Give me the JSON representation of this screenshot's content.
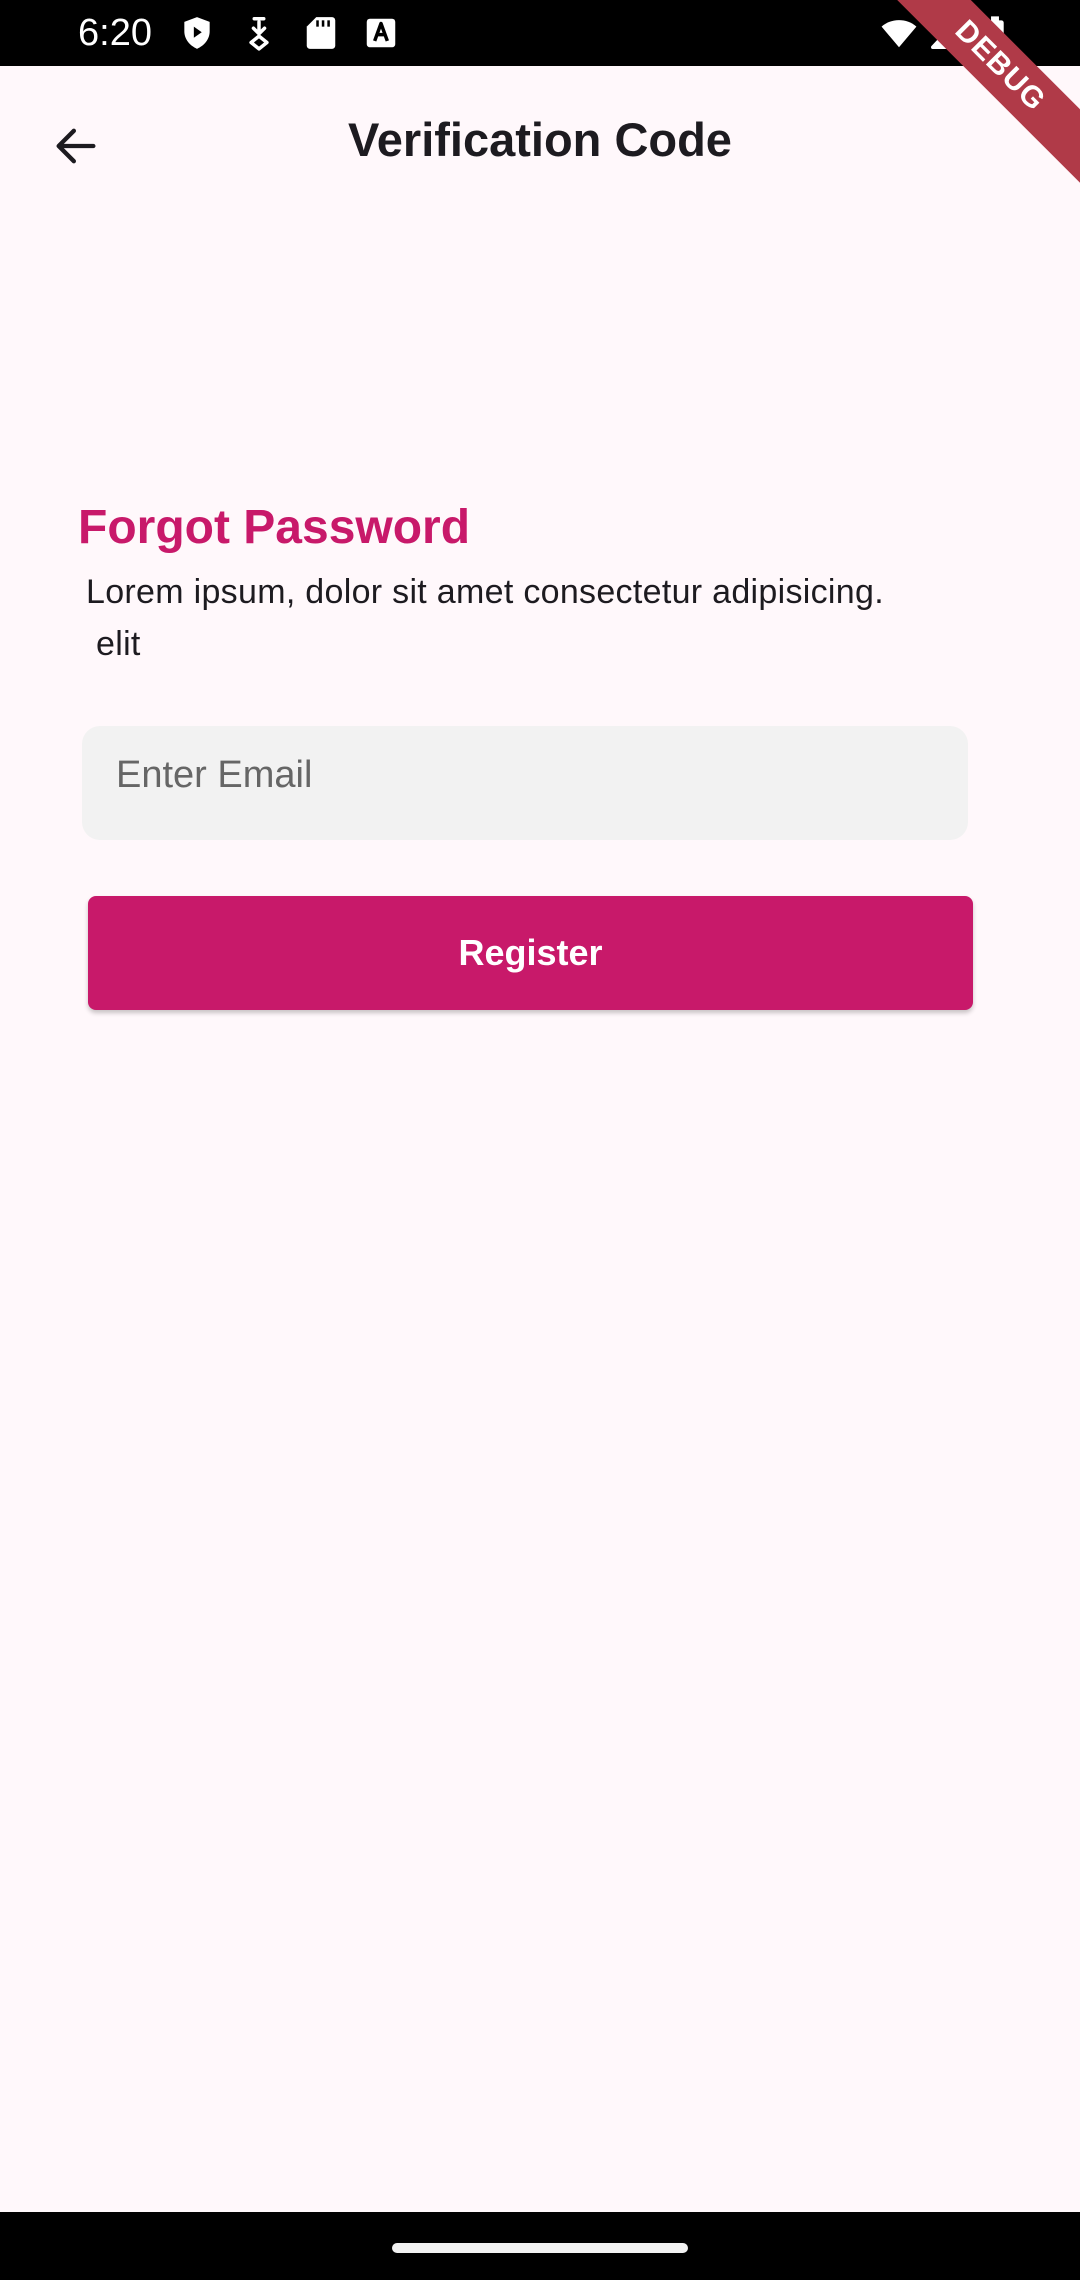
{
  "status_bar": {
    "time": "6:20",
    "icons": [
      "shield-play-icon",
      "download-arrow-icon",
      "sd-card-icon",
      "font-a-icon",
      "wifi-icon",
      "signal-icon",
      "battery-icon"
    ]
  },
  "debug_banner": "DEBUG",
  "app_bar": {
    "back_icon": "arrow-left-icon",
    "title": "Verification Code"
  },
  "content": {
    "heading": "Forgot Password",
    "description_line1": "Lorem ipsum, dolor sit amet consectetur adipisicing.",
    "description_line2": "elit",
    "email_placeholder": "Enter Email",
    "email_value": "",
    "register_label": "Register"
  },
  "colors": {
    "accent": "#c8196a",
    "background": "#fff8fb",
    "field_background": "#f2f2f2",
    "title_text": "#1d1b20",
    "debug_ribbon": "#b03a48"
  }
}
